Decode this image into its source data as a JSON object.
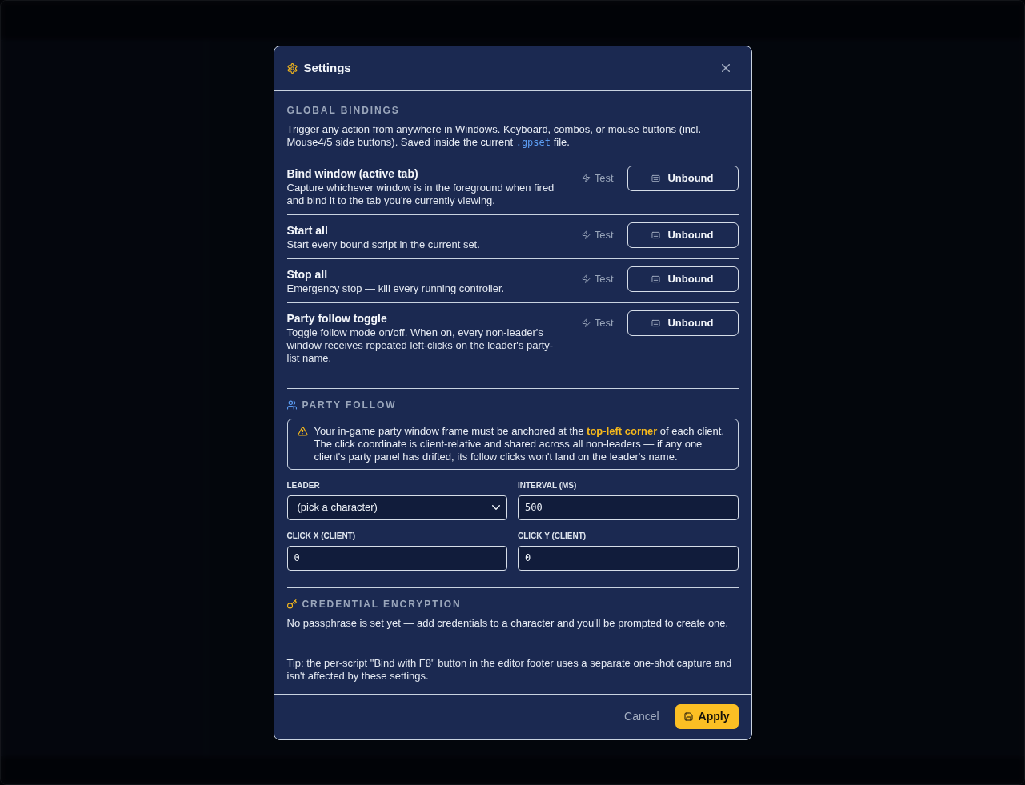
{
  "dialog": {
    "title": "Settings"
  },
  "global_bindings": {
    "heading": "GLOBAL BINDINGS",
    "description": {
      "before": "Trigger any action from anywhere in Windows. Keyboard, combos, or mouse buttons (incl. Mouse4/5 side buttons). Saved inside the current",
      "code": ".gpset",
      "after": "file."
    },
    "bindings": [
      {
        "title": "Bind window (active tab)",
        "description": "Capture whichever window is in the foreground when fired and bind it to the tab you're currently viewing.",
        "test": "Test",
        "binding": "Unbound"
      },
      {
        "title": "Start all",
        "description": "Start every bound script in the current set.",
        "test": "Test",
        "binding": "Unbound"
      },
      {
        "title": "Stop all",
        "description": "Emergency stop — kill every running controller.",
        "test": "Test",
        "binding": "Unbound"
      },
      {
        "title": "Party follow toggle",
        "description": "Toggle follow mode on/off. When on, every non-leader's window receives repeated left-clicks on the leader's party-list name.",
        "test": "Test",
        "binding": "Unbound"
      }
    ]
  },
  "party_follow": {
    "heading": "PARTY FOLLOW",
    "warning": "Your in-game party window frame must be anchored at the **top-left corner** of each client. The click coordinate is client-relative and shared across all non-leaders — if any one client's party panel has drifted, its follow clicks won't land on the leader's name.",
    "fields": [
      {
        "label": "LEADER",
        "kind": "select",
        "value": "(pick a character)"
      },
      {
        "label": "INTERVAL (MS)",
        "kind": "input",
        "value": "500"
      },
      {
        "label": "CLICK X (CLIENT)",
        "kind": "input",
        "value": "0"
      },
      {
        "label": "CLICK Y (CLIENT)",
        "kind": "input",
        "value": "0"
      }
    ]
  },
  "credential_encryption": {
    "heading": "CREDENTIAL ENCRYPTION",
    "text": "No passphrase is set yet — add credentials to a character and you'll be prompted to create one."
  },
  "tip": "Tip: the per-script \"Bind with F8\" button in the editor footer uses a separate one-shot capture and isn't affected by these settings.",
  "footer": {
    "cancel": "Cancel",
    "apply": "Apply"
  }
}
